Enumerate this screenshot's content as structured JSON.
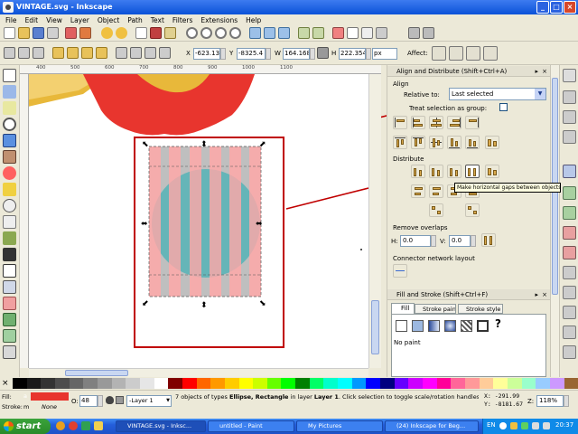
{
  "window": {
    "title": "VINTAGE.svg - Inkscape",
    "min": "_",
    "max": "□",
    "close": "×"
  },
  "menu": [
    "File",
    "Edit",
    "View",
    "Layer",
    "Object",
    "Path",
    "Text",
    "Filters",
    "Extensions",
    "Help"
  ],
  "toolcontrols": {
    "x_label": "X",
    "x_value": "-623.13",
    "y_label": "Y",
    "y_value": "-8325.4",
    "w_label": "W",
    "w_value": "164.168",
    "h_label": "H",
    "h_value": "222.354",
    "unit": "px",
    "affect_label": "Affect:"
  },
  "ruler": {
    "ticks": [
      "400",
      "500",
      "600",
      "700",
      "800",
      "900",
      "1000",
      "1100"
    ]
  },
  "align_panel": {
    "title": "Align and Distribute (Shift+Ctrl+A)",
    "align_section": "Align",
    "relative_to_label": "Relative to:",
    "relative_to_value": "Last selected",
    "treat_group_label": "Treat selection as group:",
    "distribute_section": "Distribute",
    "tooltip": "Make horizontal gaps between objects equal",
    "remove_overlaps_section": "Remove overlaps",
    "h_label": "H:",
    "h_value": "0.0",
    "v_label": "V:",
    "v_value": "0.0",
    "connector_section": "Connector network layout"
  },
  "fill_stroke_panel": {
    "title": "Fill and Stroke (Shift+Ctrl+F)",
    "tab_fill": "Fill",
    "tab_stroke_paint": "Stroke paint",
    "tab_stroke_style": "Stroke style",
    "unset_glyph": "?",
    "no_paint": "No paint"
  },
  "status": {
    "fill_label": "Fill:",
    "fill_value": "a",
    "stroke_label": "Stroke:",
    "stroke_value": "m",
    "stroke_none": "None",
    "opacity_label": "O:",
    "opacity_value": "48",
    "layer": "-Layer 1",
    "message_pre": "7 objects of types ",
    "message_types": "Ellipse, Rectangle",
    "message_mid": " in layer ",
    "message_layer": "Layer 1",
    "message_post": ". Click selection to toggle scale/rotation handles.",
    "x_readout": "X: -291.99",
    "y_readout": "Y: -8181.67",
    "zoom_label": "Z:",
    "zoom_value": "118%"
  },
  "taskbar": {
    "start": "start",
    "tasks": [
      "VINTAGE.svg - Inksc...",
      "untitled - Paint",
      "My Pictures",
      "(24) Inkscape for Beg..."
    ],
    "lang": "EN",
    "clock": "20:37"
  },
  "colors": {
    "accent_red": "#e8352e",
    "selection_box": "#c00000",
    "stripe_pink": "#f4a3a3",
    "circle_cyan": "#38e8f0",
    "stripe_gray": "#8a8a8a"
  }
}
